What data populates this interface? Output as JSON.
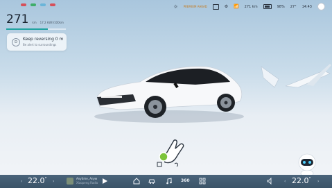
{
  "status_bar": {
    "left_indicators": [
      "#d6505a",
      "#3fae6a",
      "#6ab5d9",
      "#d6505a"
    ],
    "promo_text": "PREMIUM AHEAD",
    "range_km": "271 km",
    "battery_pct": "98%",
    "outside_temp": "27°",
    "clock": "14:43"
  },
  "range": {
    "value": "271",
    "unit": "km",
    "sub_value": "17.2 kWh/100km"
  },
  "notice": {
    "icon": "D",
    "title": "Keep reversing 0 m",
    "description": "Be alert to surroundings"
  },
  "gesture": {
    "level": 0.55
  },
  "dock": {
    "driver_temp": "22.0",
    "driver_temp_unit": "°",
    "passenger_temp": "22.0",
    "passenger_temp_unit": "°",
    "song_title": "Anytime, Anyw",
    "song_artist": "Xiaopeng Radio",
    "label_360": "360",
    "colors": {
      "dock_bg": "#3b5468",
      "accent": "#1fa3a0"
    }
  }
}
